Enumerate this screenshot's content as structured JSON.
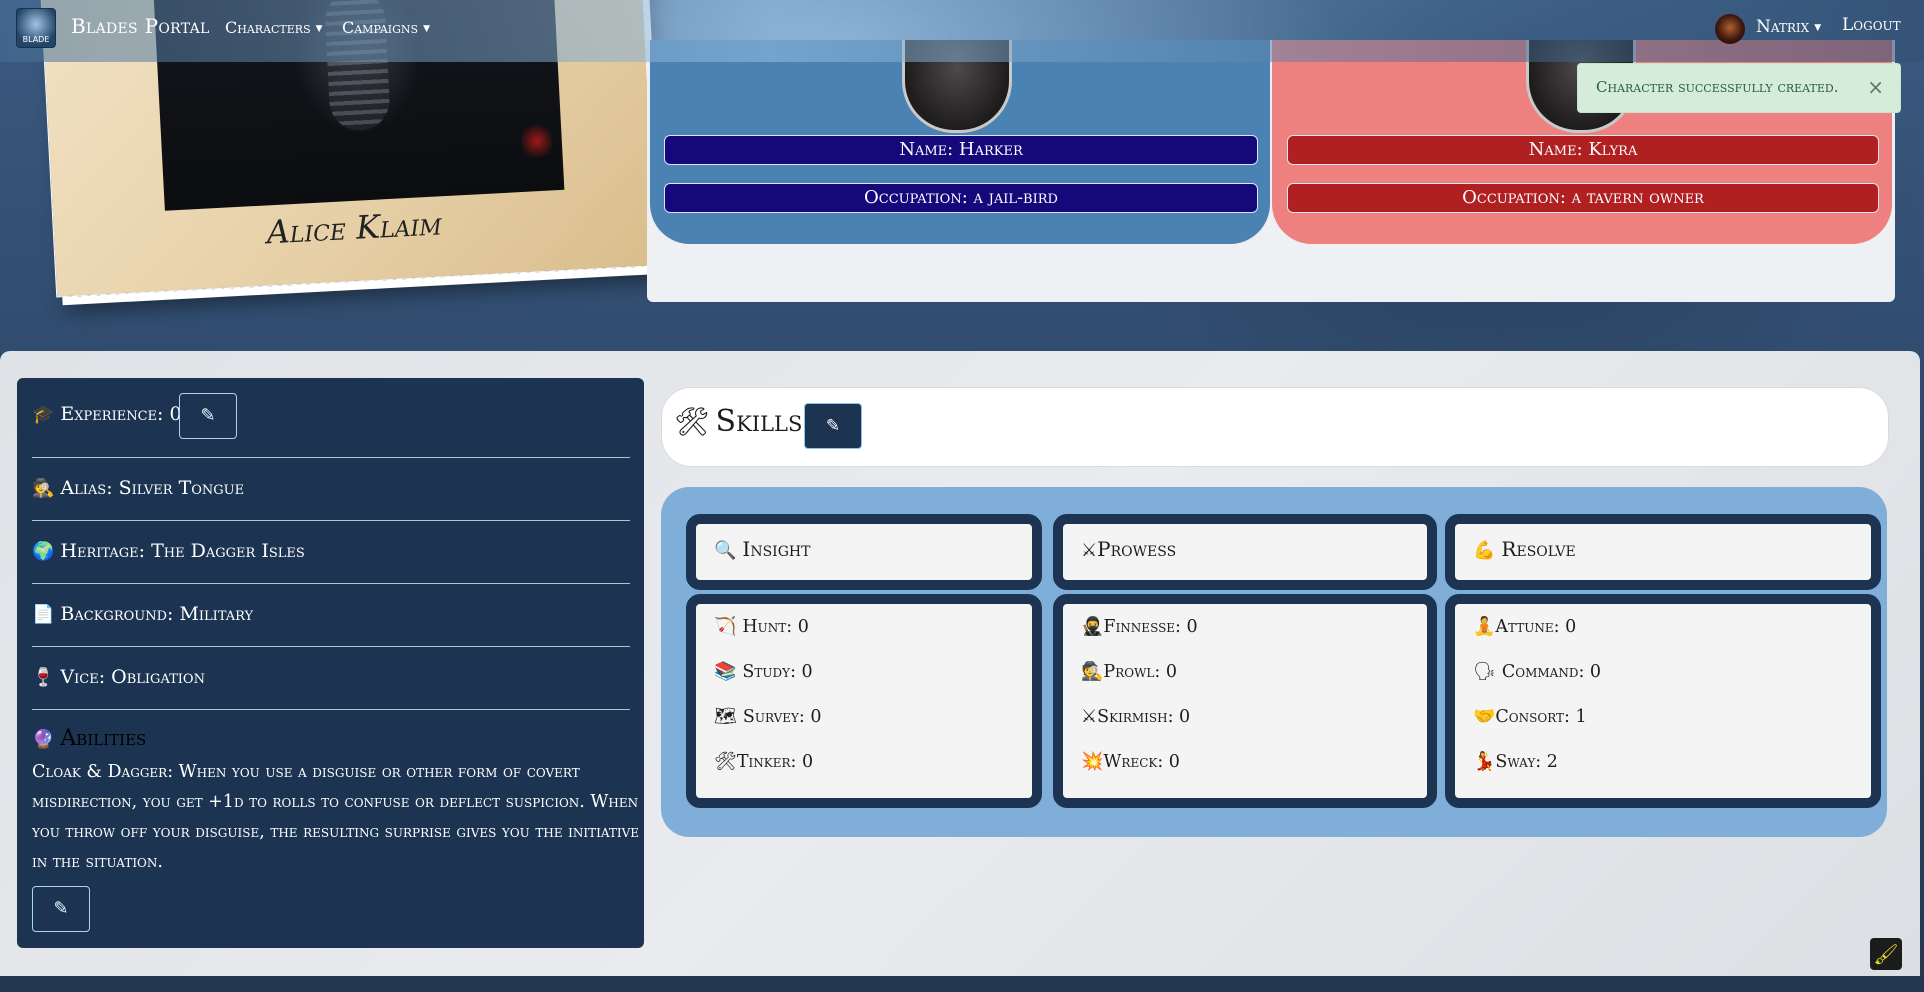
{
  "navbar": {
    "logo_text": "BLADE",
    "brand": "Blades Portal",
    "menu": [
      "Characters",
      "Campaigns"
    ],
    "user": "Natrix",
    "logout": "Logout"
  },
  "portrait": {
    "name": "Alice Klaim"
  },
  "contacts": [
    {
      "name": "Name: Harker",
      "occupation": "Occupation: a jail-bird",
      "color": "#4a82b4"
    },
    {
      "name": "Name: Klyra",
      "occupation": "Occupation: a tavern owner",
      "color": "#ef8080"
    }
  ],
  "toast": {
    "message": "Character successfully created.",
    "close": "×"
  },
  "character": {
    "experience": "Experience: 0",
    "alias": "Alias: Silver Tongue",
    "heritage": "Heritage: The Dagger Isles",
    "background": "Background: Military",
    "vice": "Vice: Obligation",
    "abilities_title": "Abilities",
    "abilities_text": "Cloak & Dagger: When you use a disguise or other form of covert misdirection, you get +1d to rolls to confuse or deflect suspicion. When you throw off your disguise, the resulting surprise gives you the initiative in the situation.",
    "icons": {
      "experience": "🎓",
      "alias": "🕵",
      "heritage": "🌍",
      "background": "📄",
      "vice": "🍷",
      "abilities": "🔮"
    }
  },
  "skills": {
    "title": "Skills",
    "title_icon": "🛠",
    "attributes": [
      {
        "label": "Insight",
        "icon": "🔍",
        "skills": [
          {
            "icon": "🏹",
            "text": "Hunt: 0"
          },
          {
            "icon": "📚",
            "text": "Study: 0"
          },
          {
            "icon": "🗺",
            "text": "Survey: 0"
          },
          {
            "icon": "🛠",
            "text": "Tinker: 0"
          }
        ]
      },
      {
        "label": "Prowess",
        "icon": "⚔",
        "skills": [
          {
            "icon": "🥷",
            "text": "Finnesse: 0"
          },
          {
            "icon": "🕵",
            "text": "Prowl: 0"
          },
          {
            "icon": "⚔",
            "text": "Skirmish: 0"
          },
          {
            "icon": "💥",
            "text": "Wreck: 0"
          }
        ]
      },
      {
        "label": "Resolve",
        "icon": "💪",
        "skills": [
          {
            "icon": "🧘",
            "text": "Attune: 0"
          },
          {
            "icon": "🗣",
            "text": "Command: 0"
          },
          {
            "icon": "🤝",
            "text": "Consort: 1"
          },
          {
            "icon": "💃",
            "text": "Sway: 2"
          }
        ]
      }
    ]
  },
  "edit_icon": "✎",
  "corner_icon": "🖌"
}
